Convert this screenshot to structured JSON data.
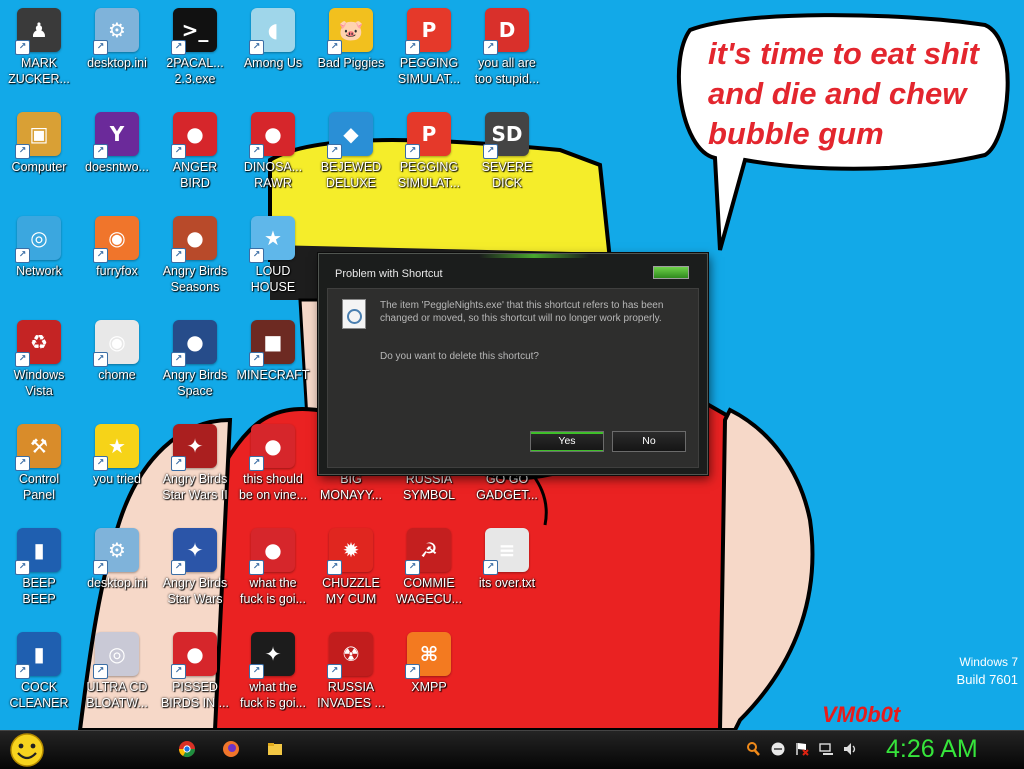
{
  "desktop": {
    "icons": [
      {
        "label": "MARK\nZUCKER...",
        "icon": "mark-zuckerberg-icon",
        "color": "#3a3a3a"
      },
      {
        "label": "desktop.ini",
        "icon": "settings-file-icon",
        "color": "#7fb3da"
      },
      {
        "label": "2PACAL...\n2.3.exe",
        "icon": "terminal-icon",
        "color": "#111111"
      },
      {
        "label": "Among Us",
        "icon": "among-us-icon",
        "color": "#9fd6ea"
      },
      {
        "label": "Bad Piggies",
        "icon": "bad-piggies-icon",
        "color": "#f2c01e"
      },
      {
        "label": "PEGGING\nSIMULAT...",
        "icon": "peggle-icon",
        "color": "#e5392a"
      },
      {
        "label": "you all are\ntoo stupid...",
        "icon": "dev-cpp-icon",
        "color": "#d9302b"
      },
      {
        "label": "Computer",
        "icon": "computer-icon",
        "color": "#d9a035"
      },
      {
        "label": "doesntwo...",
        "icon": "yahoo-messenger-icon",
        "color": "#6b2a9a"
      },
      {
        "label": "ANGER\nBIRD",
        "icon": "angry-birds-icon",
        "color": "#d6262b"
      },
      {
        "label": "DINOSA...\nRAWR",
        "icon": "angry-birds-icon",
        "color": "#d6262b"
      },
      {
        "label": "BEJEWED\nDELUXE",
        "icon": "bejeweled-icon",
        "color": "#2a8fd6"
      },
      {
        "label": "PEGGING\nSIMULAT...",
        "icon": "peggle-icon",
        "color": "#e5392a"
      },
      {
        "label": "SEVERE\nDICK",
        "icon": "speed-disk-icon",
        "color": "#444444"
      },
      {
        "label": "Network",
        "icon": "network-icon",
        "color": "#3ba7df"
      },
      {
        "label": "furryfox",
        "icon": "firefox-icon",
        "color": "#f0752b"
      },
      {
        "label": "Angry Birds\nSeasons",
        "icon": "angry-birds-seasons-icon",
        "color": "#b84a2a"
      },
      {
        "label": "LOUD\nHOUSE",
        "icon": "loud-house-icon",
        "color": "#5fb7ea"
      },
      {
        "label": "Windows\nVista",
        "icon": "recycle-bin-icon",
        "color": "#c42424"
      },
      {
        "label": "chome",
        "icon": "chrome-icon",
        "color": "#e8e8e8"
      },
      {
        "label": "Angry Birds\nSpace",
        "icon": "angry-birds-space-icon",
        "color": "#264c8a"
      },
      {
        "label": "MINECRAFT",
        "icon": "minecraft-icon",
        "color": "#6d2a22"
      },
      {
        "label": "Control\nPanel",
        "icon": "control-panel-icon",
        "color": "#d98c2a"
      },
      {
        "label": "you tried",
        "icon": "star-icon",
        "color": "#f6d318"
      },
      {
        "label": "Angry Birds\nStar Wars II",
        "icon": "angry-birds-star-wars-icon",
        "color": "#aa1f1f"
      },
      {
        "label": "this should\nbe on vine...",
        "icon": "angry-birds-icon",
        "color": "#d6262b"
      },
      {
        "label": "BIG\nMONAYY...",
        "icon": "shortcut-icon",
        "color": "#444444"
      },
      {
        "label": "RUSSIA\nSYMBOL",
        "icon": "shortcut-icon",
        "color": "#444444"
      },
      {
        "label": "GO GO\nGADGET...",
        "icon": "shortcut-icon",
        "color": "#444444"
      },
      {
        "label": "BEEP\nBEEP",
        "icon": "blue-book-icon",
        "color": "#1f5fb0"
      },
      {
        "label": "desktop.ini",
        "icon": "settings-file-icon",
        "color": "#7fb3da"
      },
      {
        "label": "Angry Birds\nStar Wars",
        "icon": "angry-birds-star-wars-icon",
        "color": "#2b55a8"
      },
      {
        "label": "what the\nfuck is goi...",
        "icon": "angry-birds-icon",
        "color": "#d6262b"
      },
      {
        "label": "CHUZZLE\nMY CUM",
        "icon": "chuzzle-icon",
        "color": "#e0261f"
      },
      {
        "label": "COMMIE\nWAGECU...",
        "icon": "soviet-emblem-icon",
        "color": "#c41f1f"
      },
      {
        "label": "its over.txt",
        "icon": "text-document-icon",
        "color": "#e7e7e7"
      },
      {
        "label": "COCK\nCLEANER",
        "icon": "blue-book-icon",
        "color": "#1f5fb0"
      },
      {
        "label": "ULTRA CD\nBLOATW...",
        "icon": "cd-icon",
        "color": "#c9c9d6"
      },
      {
        "label": "PISSED\nBIRDS IN ...",
        "icon": "angry-birds-icon",
        "color": "#d6262b"
      },
      {
        "label": "what the\nfuck is goi...",
        "icon": "angry-birds-star-wars-icon",
        "color": "#1c1c1c"
      },
      {
        "label": "RUSSIA\nINVADES ...",
        "icon": "radiation-icon",
        "color": "#c21d1d"
      },
      {
        "label": "XMPP",
        "icon": "xampp-icon",
        "color": "#f37a20"
      }
    ]
  },
  "bubble": {
    "text": "it's time to eat shit\nand die and chew\nbubble gum"
  },
  "watermark": {
    "line1": "Windows 7",
    "line2": "Build 7601",
    "signature": "VM0b0t"
  },
  "dialog": {
    "title": "Problem with Shortcut",
    "message": "The item 'PeggleNights.exe' that this shortcut refers to has been changed or moved, so this shortcut will no longer work properly.",
    "question": "Do you want to delete this shortcut?",
    "yes_label": "Yes",
    "no_label": "No",
    "accent": "#3fbf2a"
  },
  "taskbar": {
    "start_icon": "smiley-start-icon",
    "pinned": [
      "chrome-icon",
      "firefox-icon",
      "file-explorer-icon"
    ],
    "tray": [
      "search-icon",
      "chat-icon",
      "action-center-flag-icon",
      "network-icon",
      "volume-icon"
    ],
    "clock": "4:26 AM"
  }
}
